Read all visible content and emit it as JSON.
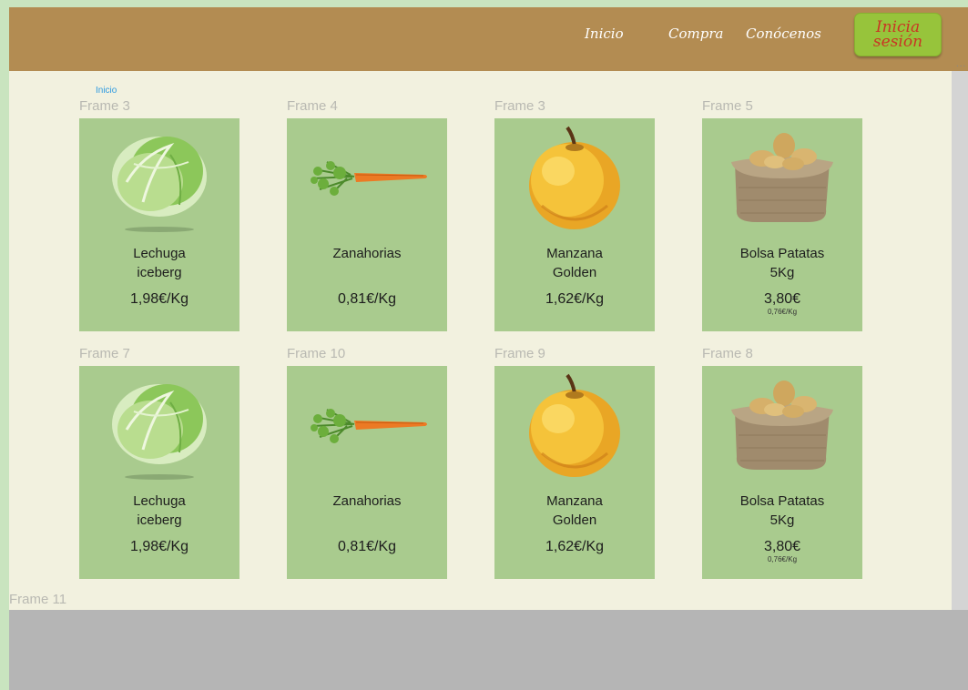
{
  "nav": {
    "links": [
      "Inicio",
      "Compra",
      "Conócenos"
    ],
    "login_line1": "Inicia",
    "login_line2": "sesión"
  },
  "canvas": {
    "mini_label": "Inicio",
    "bottom_frame_label": "Frame 11"
  },
  "products": [
    {
      "frame": "Frame 3",
      "name_line1": "Lechuga",
      "name_line2": "iceberg",
      "price": "1,98€/Kg",
      "sub": "",
      "image": "lettuce-image"
    },
    {
      "frame": "Frame 4",
      "name_line1": "Zanahorias",
      "name_line2": "",
      "price": "0,81€/Kg",
      "sub": "",
      "image": "carrot-image"
    },
    {
      "frame": "Frame 3",
      "name_line1": "Manzana",
      "name_line2": "Golden",
      "price": "1,62€/Kg",
      "sub": "",
      "image": "apple-image"
    },
    {
      "frame": "Frame 5",
      "name_line1": "Bolsa Patatas",
      "name_line2": "5Kg",
      "price": "3,80€",
      "sub": "0,76€/Kg",
      "image": "potato-sack-image"
    },
    {
      "frame": "Frame 7",
      "name_line1": "Lechuga",
      "name_line2": "iceberg",
      "price": "1,98€/Kg",
      "sub": "",
      "image": "lettuce-image"
    },
    {
      "frame": "Frame 10",
      "name_line1": "Zanahorias",
      "name_line2": "",
      "price": "0,81€/Kg",
      "sub": "",
      "image": "carrot-image"
    },
    {
      "frame": "Frame 9",
      "name_line1": "Manzana",
      "name_line2": "Golden",
      "price": "1,62€/Kg",
      "sub": "",
      "image": "apple-image"
    },
    {
      "frame": "Frame 8",
      "name_line1": "Bolsa Patatas",
      "name_line2": "5Kg",
      "price": "3,80€",
      "sub": "0,76€/Kg",
      "image": "potato-sack-image"
    }
  ],
  "colors": {
    "header": "#b38c52",
    "card": "#a9cb8e",
    "login_button": "#97c43b",
    "login_text": "#c93524",
    "background": "#f2f1df"
  }
}
